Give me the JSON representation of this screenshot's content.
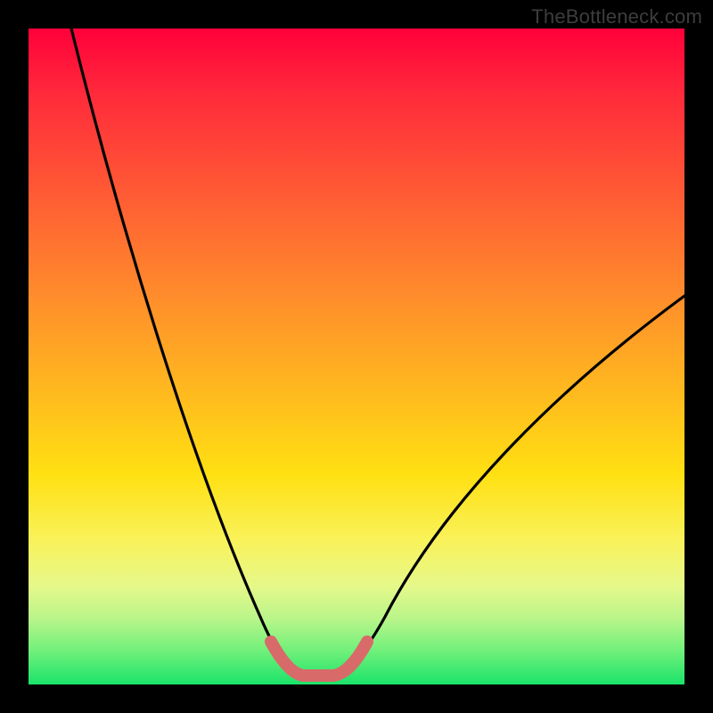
{
  "watermark": {
    "text": "TheBottleneck.com"
  },
  "colors": {
    "frame": "#000000",
    "curve": "#000000",
    "highlight": "#d86a6a",
    "gradient_top": "#ff003a",
    "gradient_bottom": "#1be36a"
  },
  "chart_data": {
    "type": "line",
    "title": "",
    "xlabel": "",
    "ylabel": "",
    "xlim": [
      0,
      100
    ],
    "ylim": [
      0,
      100
    ],
    "x": [
      0,
      5,
      10,
      15,
      20,
      25,
      30,
      35,
      38,
      40,
      42,
      44,
      46,
      48,
      50,
      55,
      60,
      65,
      70,
      75,
      80,
      85,
      90,
      95,
      100
    ],
    "series": [
      {
        "name": "bottleneck-curve",
        "values": [
          100,
          88,
          76,
          64,
          52,
          40,
          28,
          14,
          5,
          2,
          1,
          1,
          1,
          2,
          5,
          14,
          24,
          33,
          41,
          48,
          55,
          61,
          66,
          70,
          73
        ]
      }
    ],
    "highlight": {
      "name": "optimal-range",
      "x_range": [
        38,
        48
      ],
      "color": "#d86a6a"
    }
  }
}
